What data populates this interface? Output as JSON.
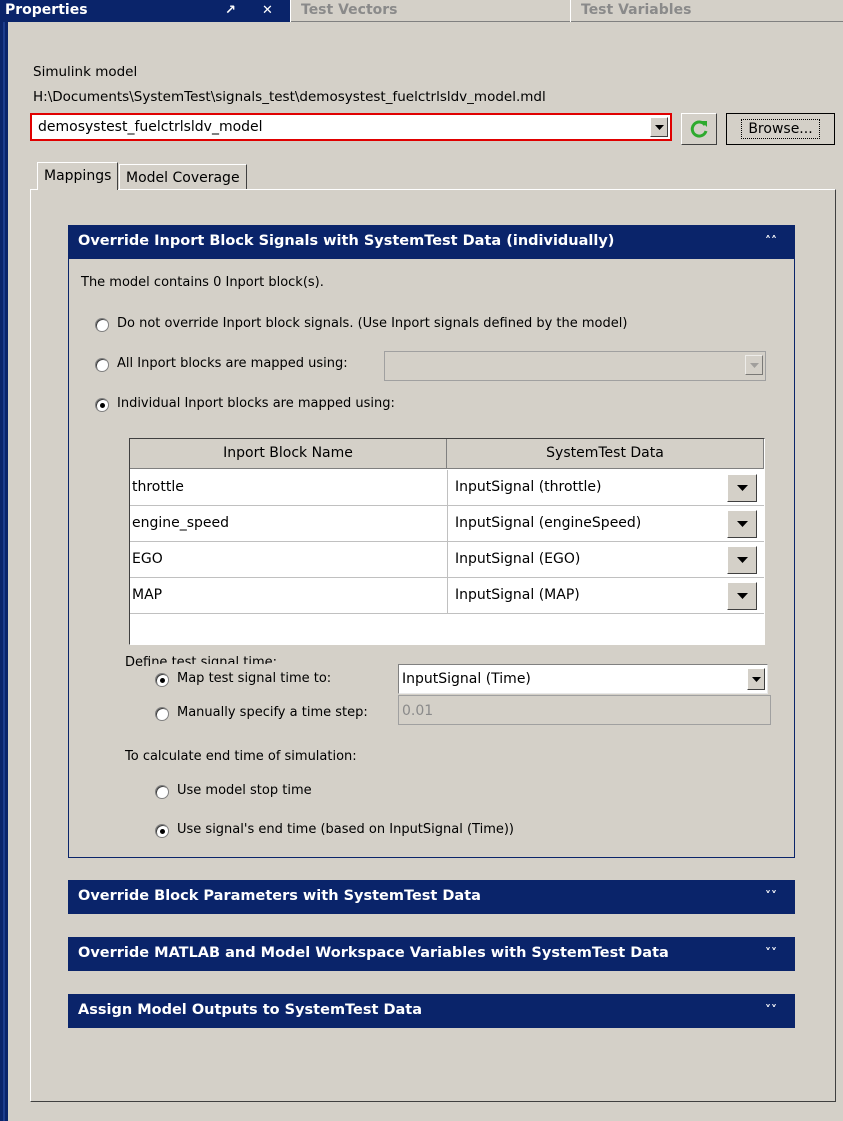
{
  "tabs": {
    "properties": "Properties",
    "pin": "↗",
    "close": "✕",
    "test_vectors": "Test Vectors",
    "test_variables": "Test Variables"
  },
  "model": {
    "section_label": "Simulink model",
    "path": "H:\\Documents\\SystemTest\\signals_test\\demosystest_fuelctrlsldv_model.mdl",
    "selected": "demosystest_fuelctrlsldv_model",
    "browse_label": "Browse..."
  },
  "inner_tabs": [
    "Mappings",
    "Model Coverage"
  ],
  "inport_section": {
    "title": "Override Inport Block Signals with SystemTest Data (individually)",
    "count_text": "The model contains 0 Inport block(s).",
    "options": [
      "Do not override Inport block signals. (Use Inport signals defined by the model)",
      "All Inport blocks are mapped using:",
      "Individual Inport blocks are mapped using:"
    ],
    "selected_option": 2,
    "all_mapping_value": "",
    "table": {
      "headers": [
        "Inport Block Name",
        "SystemTest Data"
      ],
      "rows": [
        {
          "name": "throttle",
          "data": "InputSignal (throttle)"
        },
        {
          "name": "engine_speed",
          "data": "InputSignal (engineSpeed)"
        },
        {
          "name": "EGO",
          "data": "InputSignal (EGO)"
        },
        {
          "name": "MAP",
          "data": "InputSignal (MAP)"
        }
      ]
    },
    "time": {
      "label": "Define test signal time:",
      "map_label": "Map test signal time to:",
      "map_value": "InputSignal (Time)",
      "manual_label": "Manually specify a time step:",
      "manual_value": "0.01",
      "selected": "map"
    },
    "end_time": {
      "label": "To calculate end time of simulation:",
      "model_stop": "Use model stop time",
      "signal_end": "Use signal's end time (based on InputSignal (Time))",
      "selected": "signal_end"
    }
  },
  "collapsed_sections": [
    "Override Block Parameters with SystemTest Data",
    "Override MATLAB and Model Workspace Variables with SystemTest Data",
    "Assign Model Outputs to SystemTest Data"
  ],
  "icons": {
    "refresh": "refresh-icon",
    "collapse": "chevron-double-up-icon",
    "expand": "chevron-double-down-icon",
    "dropdown": "chevron-down-icon"
  },
  "colors": {
    "section_header": "#0a246a",
    "error_border": "#e00000",
    "refresh_green": "#2eaa2e",
    "window_bg": "#d4d0c8"
  }
}
